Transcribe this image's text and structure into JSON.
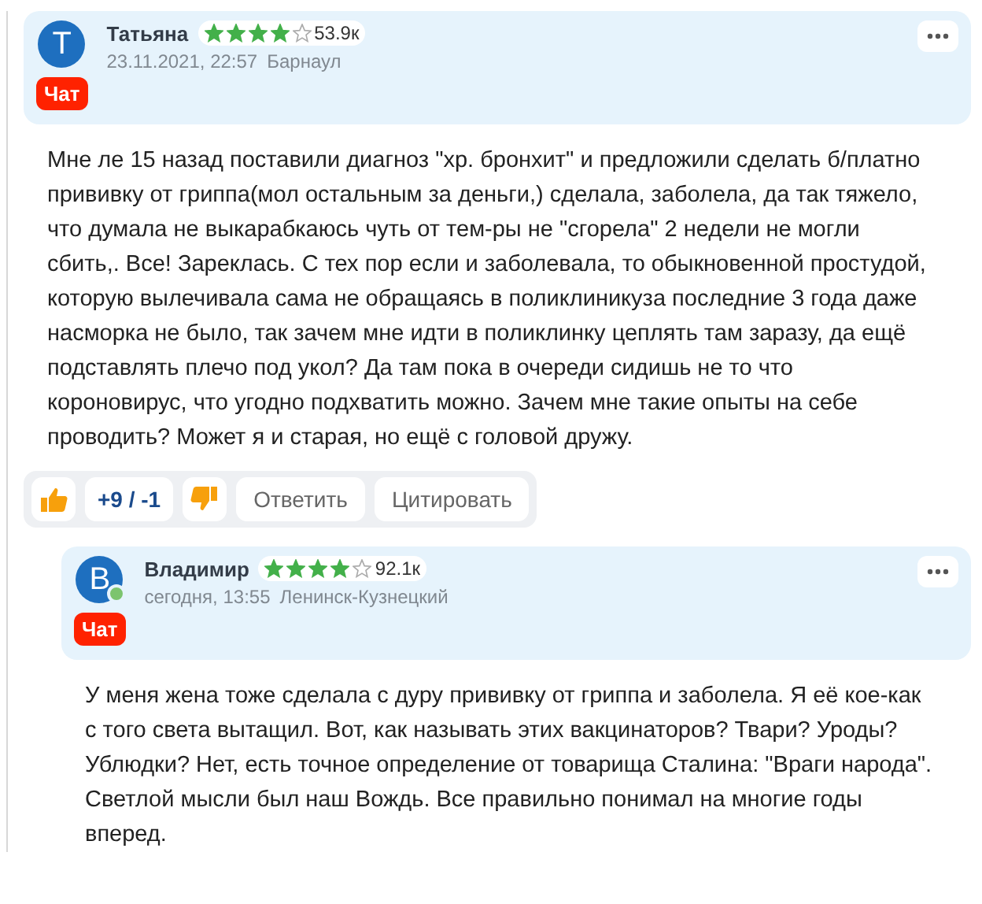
{
  "comments": [
    {
      "author": "Татьяна",
      "avatar": "Т",
      "online": false,
      "stars": 4,
      "rating": "53.9к",
      "date": "23.11.2021, 22:57",
      "city": "Барнаул",
      "badge": "Чат",
      "text": "Мне ле 15 назад поставили диагноз \"хр. бронхит\" и предложили сделать б/платно прививку от гриппа(мол остальным за деньги,) сделала, заболела, да так тяжело, что думала не выкарабкаюсь чуть от тем-ры не \"сгорела\" 2 недели не могли сбить,. Все! Зареклась. С тех пор если и заболевала, то обыкновенной простудой, которую вылечивала сама не обращаясь в поликлиникуза последние 3 года даже насморка не было, так зачем мне идти в поликлинку цеплять там заразу, да ещё подставлять плечо под укол? Да там пока в очереди сидишь не то что короновирус, что угодно подхватить можно. Зачем мне такие опыты на себе проводить? Может я и старая, но ещё с головой дружу.",
      "votes": "+9 / -1",
      "actions": [
        "Ответить",
        "Цитировать"
      ],
      "children": [
        {
          "author": "Владимир",
          "avatar": "В",
          "online": true,
          "stars": 4,
          "rating": "92.1к",
          "date": "сегодня, 13:55",
          "city": "Ленинск-Кузнецкий",
          "badge": "Чат",
          "text": "У меня жена тоже сделала с дуру прививку от гриппа и заболела. Я её кое-как с того света вытащил. Вот, как называть этих вакцинаторов? Твари? Уроды? Ублюдки? Нет, есть точное определение от товарища Сталина: \"Враги народа\". Светлой мысли был наш Вождь. Все правильно понимал на многие годы вперед."
        }
      ]
    }
  ]
}
